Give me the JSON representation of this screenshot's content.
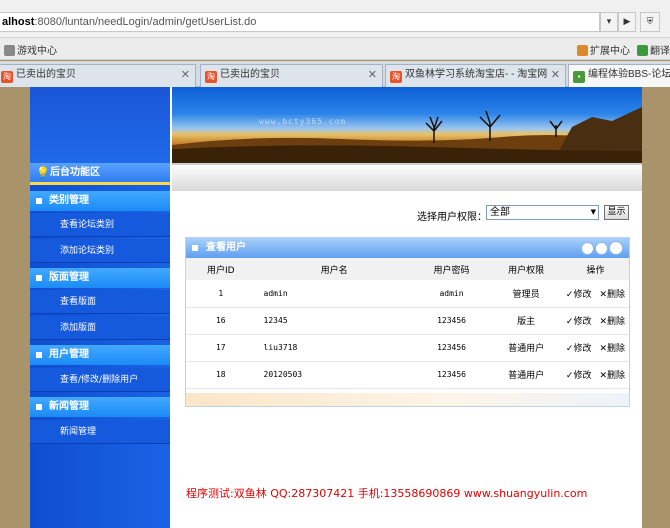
{
  "browser": {
    "url_host": "alhost",
    "url_rest": ":8080/luntan/needLogin/admin/getUserList.do",
    "bookmarks": [
      {
        "label": "游戏中心",
        "icon": "gamepad-icon"
      },
      {
        "label": "扩展中心",
        "icon": "extension-icon"
      },
      {
        "label": "翻译",
        "icon": "translate-icon"
      }
    ],
    "tabs": [
      {
        "label": "已卖出的宝贝",
        "icon": "taobao-icon"
      },
      {
        "label": "已卖出的宝贝",
        "icon": "taobao-icon"
      },
      {
        "label": "双鱼林学习系统淘宝店- - 淘宝网",
        "icon": "taobao-icon"
      },
      {
        "label": "编程体验BBS-论坛 |",
        "icon": "page-icon"
      }
    ]
  },
  "banner": {
    "site_text": "www.bcty365.com"
  },
  "sidebar": {
    "title": "后台功能区",
    "sections": [
      {
        "label": "类别管理",
        "items": [
          "查看论坛类别",
          "添加论坛类别"
        ]
      },
      {
        "label": "版面管理",
        "items": [
          "查看版面",
          "添加版面"
        ]
      },
      {
        "label": "用户管理",
        "items": [
          "查看/修改/删除用户"
        ]
      },
      {
        "label": "新闻管理",
        "items": [
          "新闻管理"
        ]
      }
    ]
  },
  "filter": {
    "label": "选择用户权限：",
    "selected": "全部",
    "button": "显示"
  },
  "panel": {
    "title": "查看用户",
    "columns": [
      "用户ID",
      "用户名",
      "用户密码",
      "用户权限",
      "操作"
    ],
    "rows": [
      {
        "id": "1",
        "name": "admin",
        "password": "admin",
        "role": "管理员"
      },
      {
        "id": "16",
        "name": "12345",
        "password": "123456",
        "role": "版主"
      },
      {
        "id": "17",
        "name": "liu3718",
        "password": "123456",
        "role": "普通用户"
      },
      {
        "id": "18",
        "name": "20120503",
        "password": "123456",
        "role": "普通用户"
      }
    ],
    "edit_label": "✓修改",
    "delete_label": "✕删除"
  },
  "footer": {
    "text": "程序测试:双鱼林 QQ:287307421 手机:13558690869 www.shuangyulin.com"
  },
  "colors": {
    "sidebar": "#1559dd",
    "accent": "#ffd84a",
    "footer": "#e40000"
  }
}
